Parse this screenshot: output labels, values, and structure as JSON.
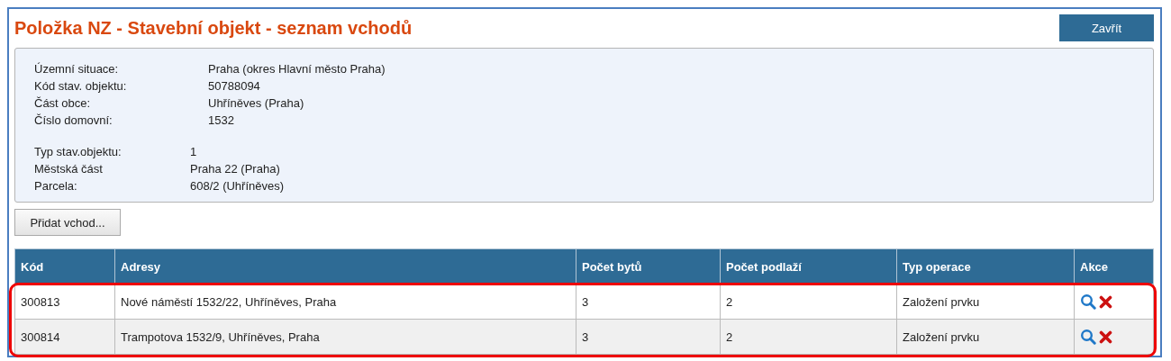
{
  "title": "Položka NZ - Stavební objekt - seznam vchodů",
  "close_button": "Zavřít",
  "info_groups": [
    {
      "fields": [
        {
          "label": "Územní situace:",
          "value": "Praha (okres Hlavní město Praha)"
        },
        {
          "label": "Kód stav. objektu:",
          "value": "50788094"
        },
        {
          "label": "Část obce:",
          "value": "Uhříněves (Praha)"
        },
        {
          "label": "Číslo domovní:",
          "value": "1532"
        }
      ]
    },
    {
      "fields": [
        {
          "label": "Typ stav.objektu:",
          "value": "1"
        },
        {
          "label": "Městská část",
          "value": "Praha 22 (Praha)"
        },
        {
          "label": "Parcela:",
          "value": "608/2 (Uhříněves)"
        }
      ]
    }
  ],
  "add_button": "Přidat vchod...",
  "table": {
    "columns": [
      "Kód",
      "Adresy",
      "Počet bytů",
      "Počet podlaží",
      "Typ operace",
      "Akce"
    ],
    "rows_highlighted": true,
    "rows": [
      {
        "cells": [
          "300813",
          "Nové náměstí 1532/22, Uhříněves, Praha",
          "3",
          "2",
          "Založení prvku"
        ]
      },
      {
        "cells": [
          "300814",
          "Trampotova 1532/9, Uhříněves, Praha",
          "3",
          "2",
          "Založení prvku"
        ]
      }
    ]
  }
}
